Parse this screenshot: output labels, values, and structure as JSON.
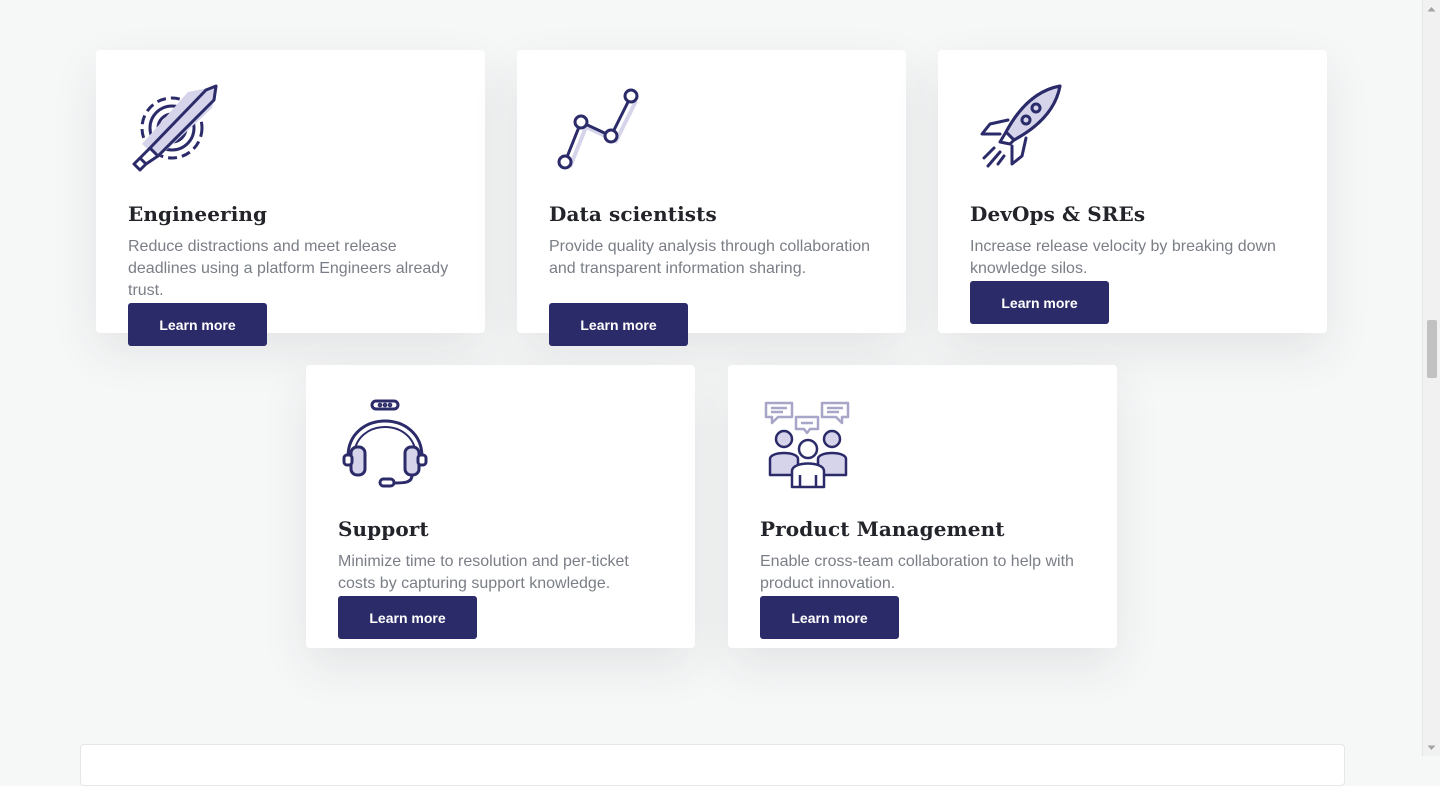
{
  "cards": [
    {
      "icon": "gear-pencil-icon",
      "title": "Engineering",
      "description": "Reduce distractions and meet release deadlines using a platform Engineers already trust.",
      "button": "Learn more"
    },
    {
      "icon": "line-graph-icon",
      "title": "Data scientists",
      "description": "Provide quality analysis through collaboration and transparent information sharing.",
      "button": "Learn more"
    },
    {
      "icon": "rocket-icon",
      "title": "DevOps & SREs",
      "description": "Increase release velocity by breaking down knowledge silos.",
      "button": "Learn more"
    },
    {
      "icon": "headset-icon",
      "title": "Support",
      "description": "Minimize time to resolution and per-ticket costs by capturing support knowledge.",
      "button": "Learn more"
    },
    {
      "icon": "team-chat-icon",
      "title": "Product Management",
      "description": "Enable cross-team collaboration to help with product innovation.",
      "button": "Learn more"
    }
  ],
  "colors": {
    "primary": "#2c2b6a",
    "icon_stroke": "#2c2b6a",
    "icon_fill": "#d5d4ea",
    "heading": "#22242a",
    "body_text": "#7a7e86",
    "background": "#f6f7f7"
  }
}
